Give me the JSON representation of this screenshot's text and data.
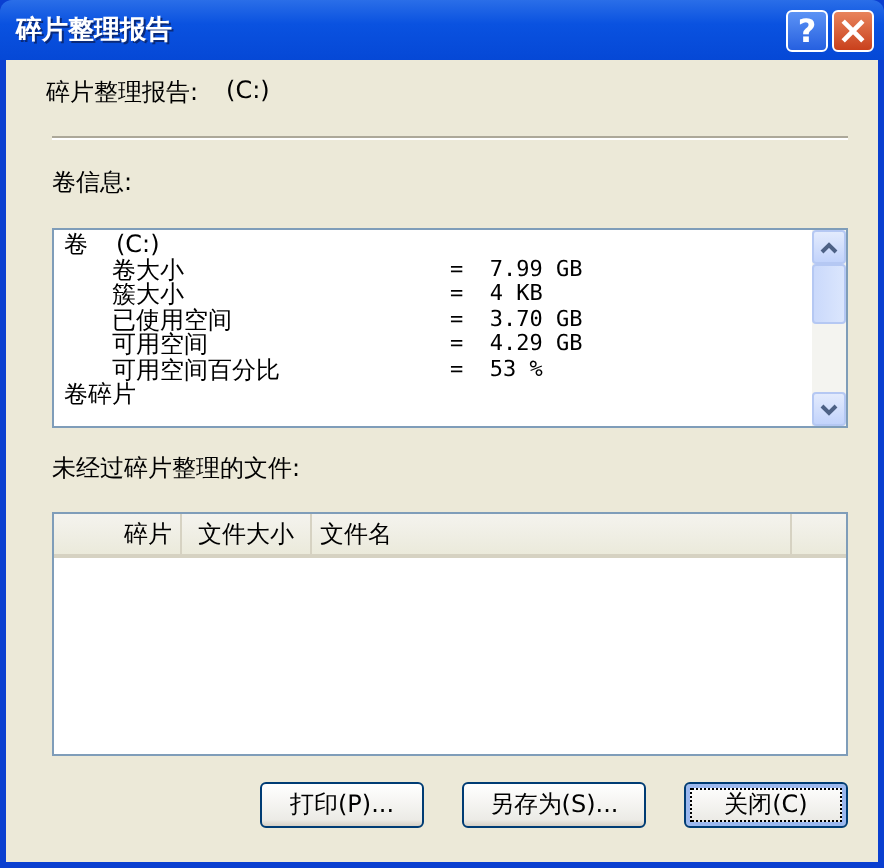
{
  "window": {
    "title": "碎片整理报告",
    "help_button": "?"
  },
  "report": {
    "label": "碎片整理报告:",
    "drive": "(C:)"
  },
  "volume_info": {
    "label": "卷信息:",
    "items": [
      {
        "label": "卷",
        "detail": "(C:)",
        "children": [
          {
            "label": "卷大小",
            "value": "=  7.99 GB"
          },
          {
            "label": "簇大小",
            "value": "=  4 KB"
          },
          {
            "label": "已使用空间",
            "value": "=  3.70 GB"
          },
          {
            "label": "可用空间",
            "value": "=  4.29 GB"
          },
          {
            "label": "可用空间百分比",
            "value": "=  53 %"
          }
        ]
      },
      {
        "label": "卷碎片"
      }
    ]
  },
  "files": {
    "label": "未经过碎片整理的文件:",
    "columns": [
      "碎片",
      "文件大小",
      "文件名"
    ]
  },
  "buttons": [
    {
      "label": "打印(P)...",
      "default": false
    },
    {
      "label": "另存为(S)...",
      "default": false
    },
    {
      "label": "关闭(C)",
      "default": true
    }
  ]
}
